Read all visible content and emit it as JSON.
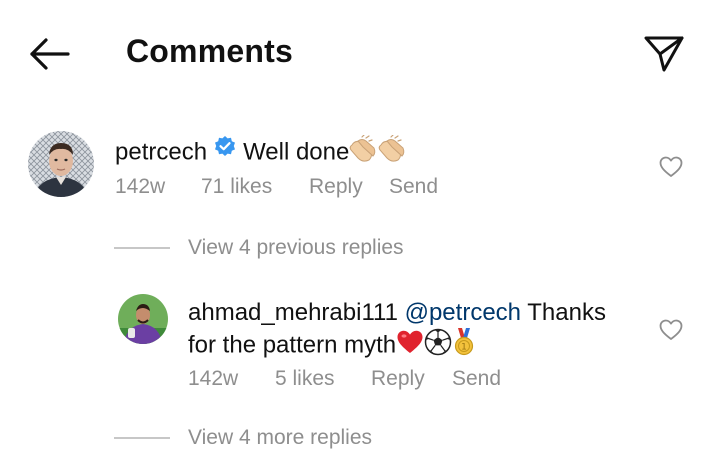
{
  "header": {
    "title": "Comments"
  },
  "comment": {
    "username": "petrcech",
    "text": "Well done",
    "time": "142w",
    "likes": "71 likes",
    "reply_label": "Reply",
    "send_label": "Send"
  },
  "view_previous": "View 4 previous replies",
  "reply": {
    "username": "ahmad_mehrabi111",
    "mention": "@petrcech",
    "text_line1_suffix": "Thanks",
    "text_line2": "for the pattern myth",
    "time": "142w",
    "likes": "5 likes",
    "reply_label": "Reply",
    "send_label": "Send"
  },
  "view_more": "View 4 more replies",
  "colors": {
    "verified_blue": "#3897f0",
    "mention_blue": "#00376b",
    "meta_gray": "#8e8e8e"
  },
  "icons": {
    "back": "arrow-left-icon",
    "send": "paper-plane-icon",
    "verified": "verified-badge-icon",
    "like": "heart-outline-icon"
  }
}
